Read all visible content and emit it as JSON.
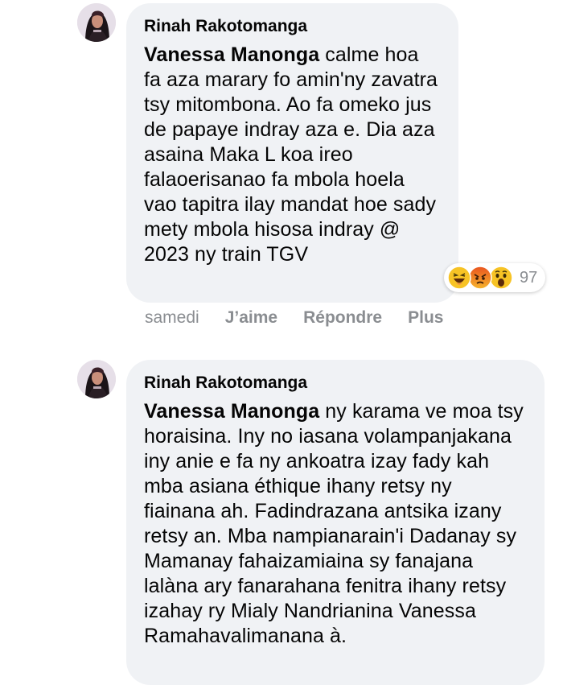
{
  "comments": [
    {
      "author": "Rinah Rakotomanga",
      "mention": "Vanessa Manonga",
      "text": " calme hoa fa aza marary fo amin'ny zavatra tsy mitombona. Ao fa omeko jus de papaye indray aza e. Dia aza asaina Maka L koa ireo falaoerisanao fa mbola hoela vao tapitra ilay mandat hoe sady mety mbola hisosa indray @ 2023 ny train TGV",
      "reactions": {
        "icons": [
          "laughing-reaction-icon",
          "angry-reaction-icon",
          "wow-reaction-icon"
        ],
        "count": "97"
      },
      "actions": {
        "time": "samedi",
        "like": "J’aime",
        "reply": "Répondre",
        "more": "Plus"
      }
    },
    {
      "author": "Rinah Rakotomanga",
      "mention": "Vanessa Manonga",
      "text": " ny karama ve moa tsy horaisina. Iny no iasana volampanjakana iny anie e fa ny ankoatra izay fady kah mba asiana éthique ihany retsy ny fiainana ah. Fadindrazana antsika izany retsy an. Mba nampianarain'i Dadanay sy Mamanay fahaizamiaina sy fanajana lalàna ary fanarahana fenitra ihany retsy izahay ry Mialy Nandrianina Vanessa Ramahavalimanana à."
    }
  ],
  "colors": {
    "bubble": "#f0f2f5",
    "secondary_text": "#8a8d91",
    "text": "#050505"
  }
}
